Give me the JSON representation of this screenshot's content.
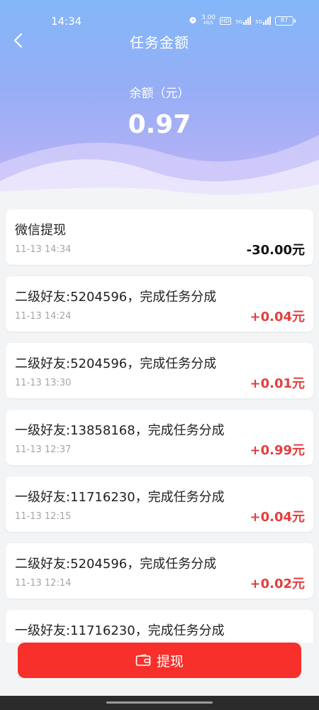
{
  "status": {
    "time": "14:34",
    "speed": "3.00",
    "speed_unit": "KB/S",
    "hd": "HD",
    "net1": "5G",
    "net2": "5G",
    "battery": "87"
  },
  "header": {
    "title": "任务金额",
    "balance_label": "余额（元）",
    "balance_value": "0.97"
  },
  "records": [
    {
      "title": "微信提现",
      "time": "11-13 14:34",
      "amount": "-30.00元",
      "sign": "neg"
    },
    {
      "title": "二级好友:5204596，完成任务分成",
      "time": "11-13 14:24",
      "amount": "+0.04元",
      "sign": "pos"
    },
    {
      "title": "二级好友:5204596，完成任务分成",
      "time": "11-13 13:30",
      "amount": "+0.01元",
      "sign": "pos"
    },
    {
      "title": "一级好友:13858168，完成任务分成",
      "time": "11-13 12:37",
      "amount": "+0.99元",
      "sign": "pos"
    },
    {
      "title": "一级好友:11716230，完成任务分成",
      "time": "11-13 12:15",
      "amount": "+0.04元",
      "sign": "pos"
    },
    {
      "title": "二级好友:5204596，完成任务分成",
      "time": "11-13 12:14",
      "amount": "+0.02元",
      "sign": "pos"
    },
    {
      "title": "一级好友:11716230，完成任务分成",
      "time": "",
      "amount": "",
      "sign": "pos"
    }
  ],
  "withdraw": {
    "label": "提现"
  },
  "colors": {
    "accent": "#f7302b",
    "positive": "#e43d3d",
    "header_top": "#83b7f9",
    "header_bottom": "#c2b3f7"
  }
}
